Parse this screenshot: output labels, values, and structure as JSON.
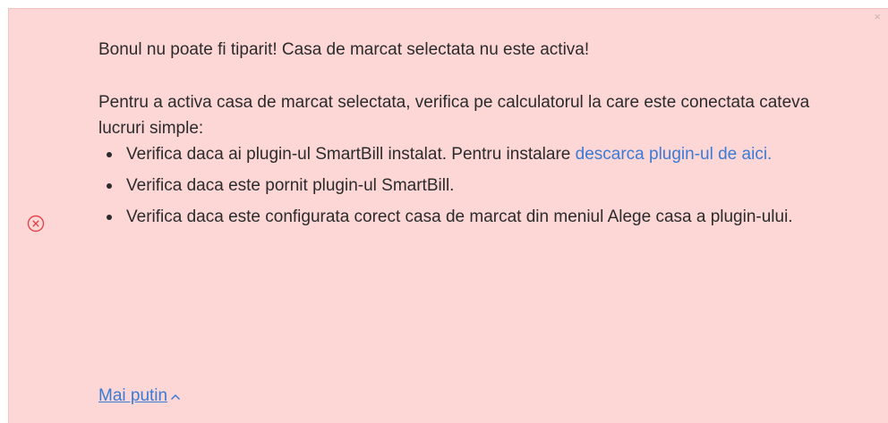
{
  "alert": {
    "close_glyph": "×",
    "icon": "error-circle-x-icon",
    "title": "Bonul nu poate fi tiparit! Casa de marcat selectata nu este activa!",
    "intro": "Pentru a activa casa de marcat selectata, verifica pe calculatorul la care este conectata cateva lucruri simple:",
    "items": [
      {
        "text": "Verifica daca ai plugin-ul SmartBill instalat. Pentru instalare ",
        "link": "descarca plugin-ul de aici."
      },
      {
        "text": "Verifica daca este pornit plugin-ul SmartBill."
      },
      {
        "text": "Verifica daca este configurata corect casa de marcat din meniul Alege casa a plugin-ului."
      }
    ],
    "toggle_label": "Mai putin",
    "toggle_icon": "chevron-up-icon"
  },
  "colors": {
    "background": "#fdd6d6",
    "link": "#3a7bd5",
    "error_icon": "#e0474c"
  }
}
